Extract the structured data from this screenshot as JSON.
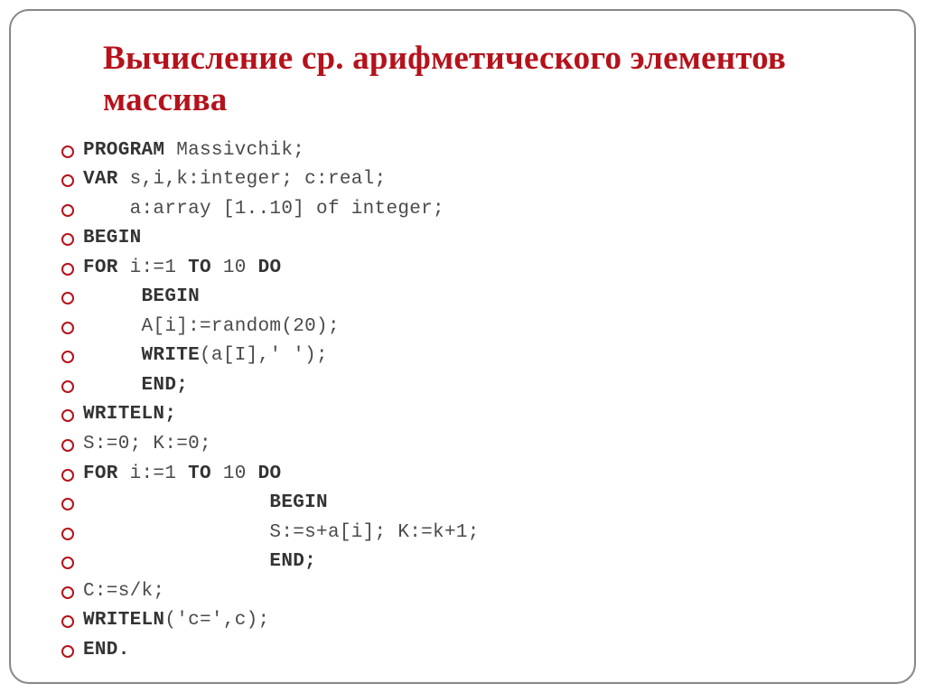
{
  "title": "Вычисление  ср. арифметического элементов массива",
  "lines": [
    {
      "kw": "Program",
      "rest": " Massivchik;"
    },
    {
      "kw": "Var",
      "rest": " s,i,k:integer; c:real;"
    },
    {
      "kw": "",
      "rest": "    a:array [1..10] of integer;"
    },
    {
      "kw": "BEGIN",
      "rest": ""
    },
    {
      "kw": "For",
      "rest": " i:=1 ",
      "kw2": "to",
      "rest2": " 10 ",
      "kw3": "do",
      "rest3": ""
    },
    {
      "kw": "     Begin",
      "rest": ""
    },
    {
      "kw": "",
      "rest": "     A[i]:=random(20);"
    },
    {
      "kw": "     Write",
      "rest": "(a[I],' ');"
    },
    {
      "kw": "     End;",
      "rest": ""
    },
    {
      "kw": "Writeln;",
      "rest": ""
    },
    {
      "kw": "",
      "rest": "S:=0; K:=0;"
    },
    {
      "kw": "for",
      "rest": " i:=1 ",
      "kw2": "to",
      "rest2": " 10 ",
      "kw3": "do",
      "rest3": ""
    },
    {
      "kw": "                Begin",
      "rest": ""
    },
    {
      "kw": "",
      "rest": "                S:=s+a[i]; K:=k+1;"
    },
    {
      "kw": "                End;",
      "rest": ""
    },
    {
      "kw": "",
      "rest": "C:=s/k;"
    },
    {
      "kw": "Writeln",
      "rest": "('c=',c);"
    },
    {
      "kw": "END.",
      "rest": ""
    }
  ]
}
